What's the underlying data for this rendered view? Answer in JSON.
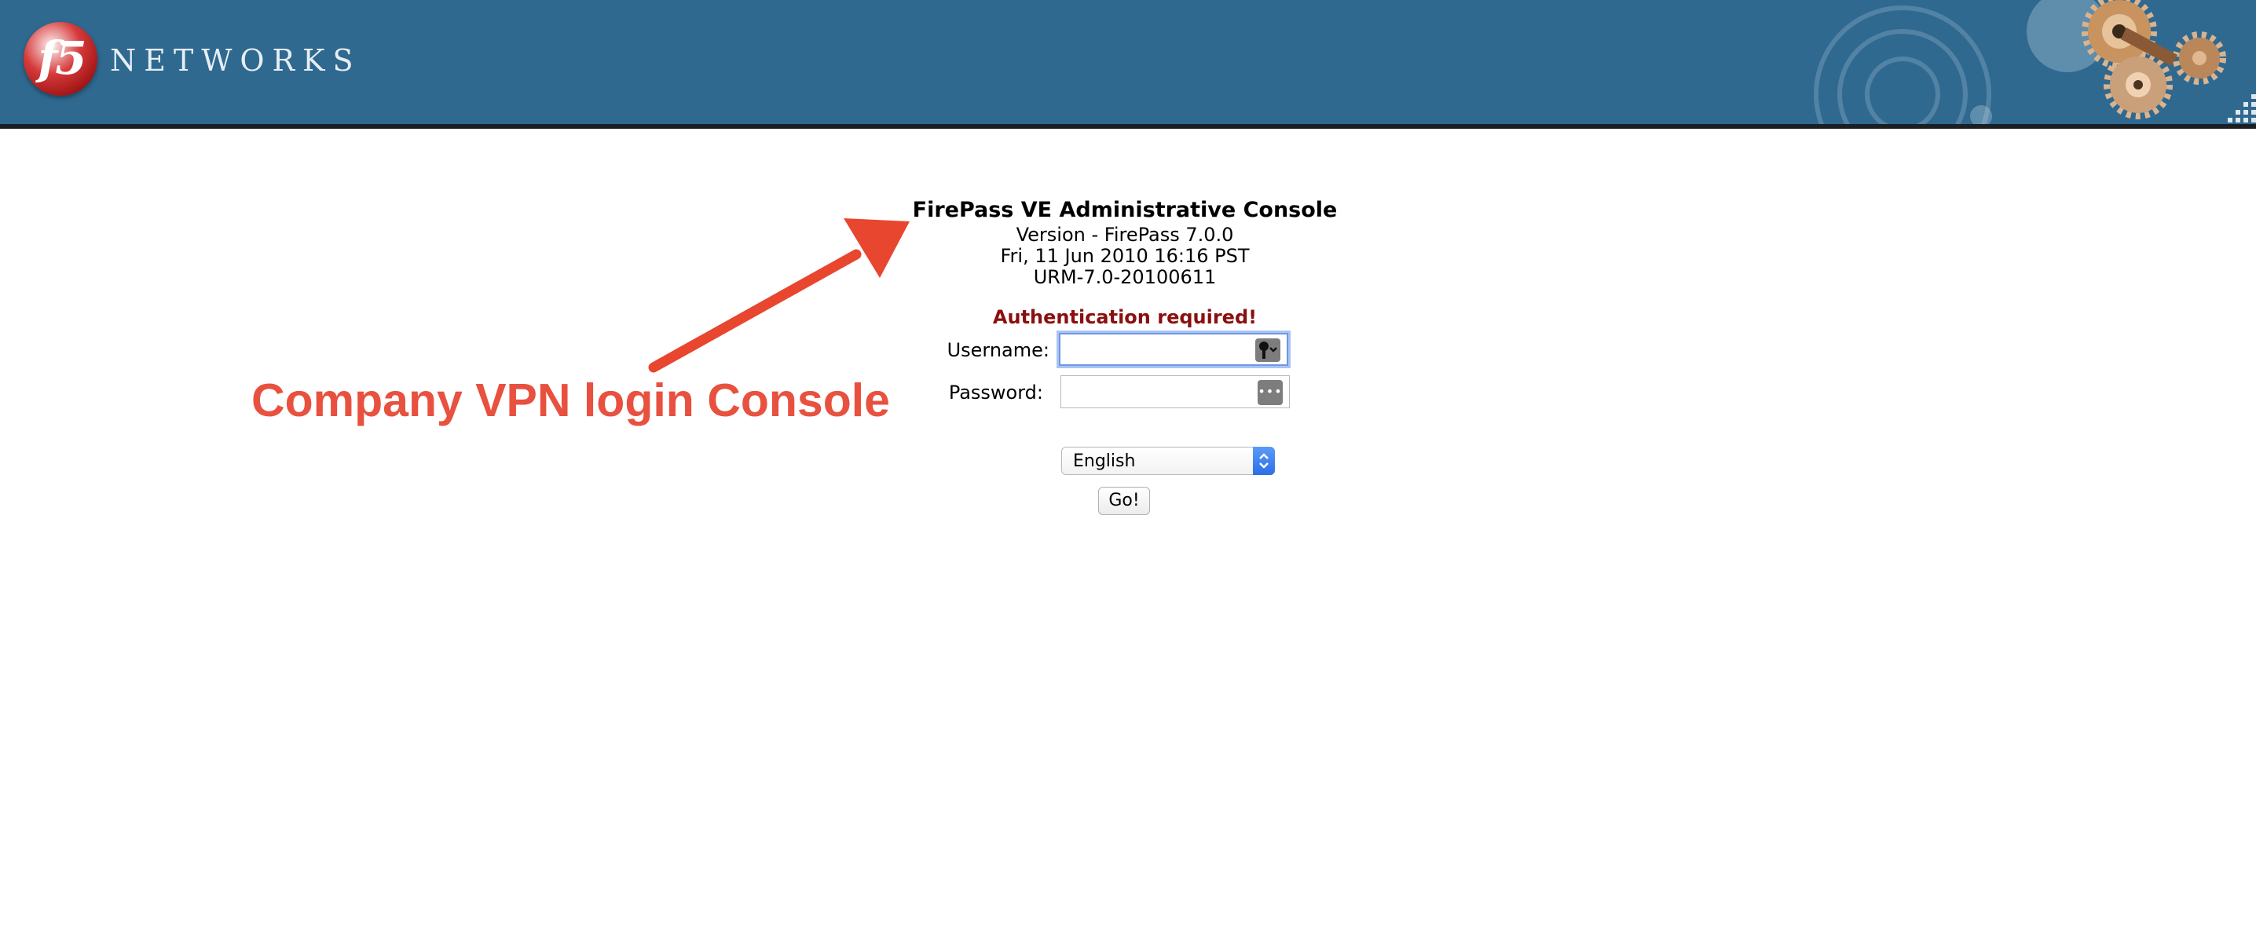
{
  "header": {
    "logo": {
      "mark": "f5",
      "wordmark": "NETWORKS"
    },
    "colors": {
      "band": "#2f6990",
      "rule": "#1b1f24"
    }
  },
  "annotation": {
    "text": "Company VPN login Console",
    "color": "#e8513f"
  },
  "login": {
    "title": "FirePass VE Administrative Console",
    "version": "Version - FirePass 7.0.0",
    "date": "Fri, 11 Jun 2010 16:16 PST",
    "build": "URM-7.0-20100611",
    "auth_message": "Authentication required!",
    "auth_message_color": "#8b0f0f",
    "username": {
      "label": "Username:",
      "value": "",
      "autofill_icon": "key-icon"
    },
    "password": {
      "label": "Password:",
      "value": "",
      "autofill_icon": "password-dots-icon",
      "autofill_glyph": "•••"
    },
    "language": {
      "selected": "English"
    },
    "submit_label": "Go!"
  }
}
